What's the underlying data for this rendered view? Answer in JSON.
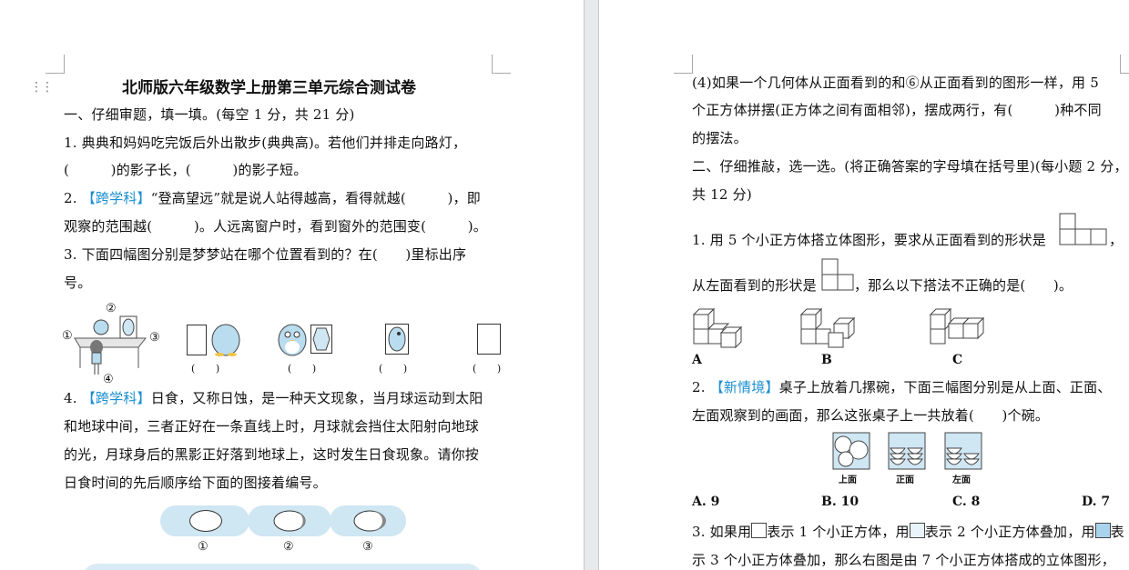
{
  "left": {
    "title": "北师版六年级数学上册第三单元综合测试卷",
    "section1": "一、仔细审题，填一填。(每空 1 分，共 21 分)",
    "q1_line1": "1. 典典和妈妈吃完饭后外出散步(典典高)。若他们并排走向路灯，",
    "q1_line2": "(　　　)的影子长，(　　　)的影子短。",
    "q2_tag": "【跨学科】",
    "q2_line1": "“登高望远”就是说人站得越高，看得就越(　　　)，即",
    "q2_line2": "观察的范围越(　　　)。人远离窗户时，看到窗外的范围变(　　　)。",
    "q3_line1": "3. 下面四幅图分别是梦梦站在哪个位置看到的？在(　　)里标出序",
    "q3_line2": "号。",
    "q3_num1": "①",
    "q3_num2": "②",
    "q3_num3": "③",
    "q3_num4": "④",
    "q3_paren": "(　　)",
    "q4_tag": "【跨学科】",
    "q4_line1": "日食，又称日蚀，是一种天文现象，当月球运动到太阳",
    "q4_line2": "和地球中间，三者正好在一条直线上时，月球就会挡住太阳射向地球",
    "q4_line3": "的光，月球身后的黑影正好落到地球上，这时发生日食现象。请你按",
    "q4_line4": "日食时间的先后顺序给下面的图接着编号。",
    "eclipse_labels": [
      "①",
      "②",
      "③"
    ]
  },
  "right": {
    "q4b_line1": "(4)如果一个几何体从正面看到的和⑥从正面看到的图形一样，用 5",
    "q4b_line2": "个正方体拼摆(正方体之间有面相邻)，摆成两行，有(　　　)种不同",
    "q4b_line3": "的摆法。",
    "section2_line1": "二、仔细推敲，选一选。(将正确答案的字母填在括号里)(每小题 2 分，",
    "section2_line2": "共 12 分)",
    "s2q1_line1": "1. 用 5 个小正方体搭立体图形，要求从正面看到的形状是",
    "s2q1_line1_end": "，",
    "s2q1_line2a": "从左面看到的形状是",
    "s2q1_line2b": "，那么以下搭法不正确的是(　　)。",
    "s2q1_opts": [
      "A",
      "B",
      "C"
    ],
    "s2q2_num": "2.",
    "s2q2_tag": "【新情境】",
    "s2q2_line1": "桌子上放着几摞碗，下面三幅图分别是从上面、正面、",
    "s2q2_line2": "左面观察到的画面，那么这张桌子上一共放着(　　)个碗。",
    "bowl_caps": [
      "上面",
      "正面",
      "左面"
    ],
    "s2q2_opts": [
      "A. 9",
      "B. 10",
      "C. 8",
      "D. 7"
    ],
    "s2q3_line1a": "3. 如果用",
    "s2q3_line1b": "表示 1 个小正方体，用",
    "s2q3_line1c": "表示 2 个小正方体叠加，用",
    "s2q3_line1d": "表",
    "s2q3_line2": "示 3 个小正方体叠加，那么右图是由 7 个小正方体搭成的立体图形，"
  },
  "colors": {
    "accent": "#1b8fd1",
    "cloud": "#cfe6f3",
    "cube_light": "#cfe6f3"
  }
}
